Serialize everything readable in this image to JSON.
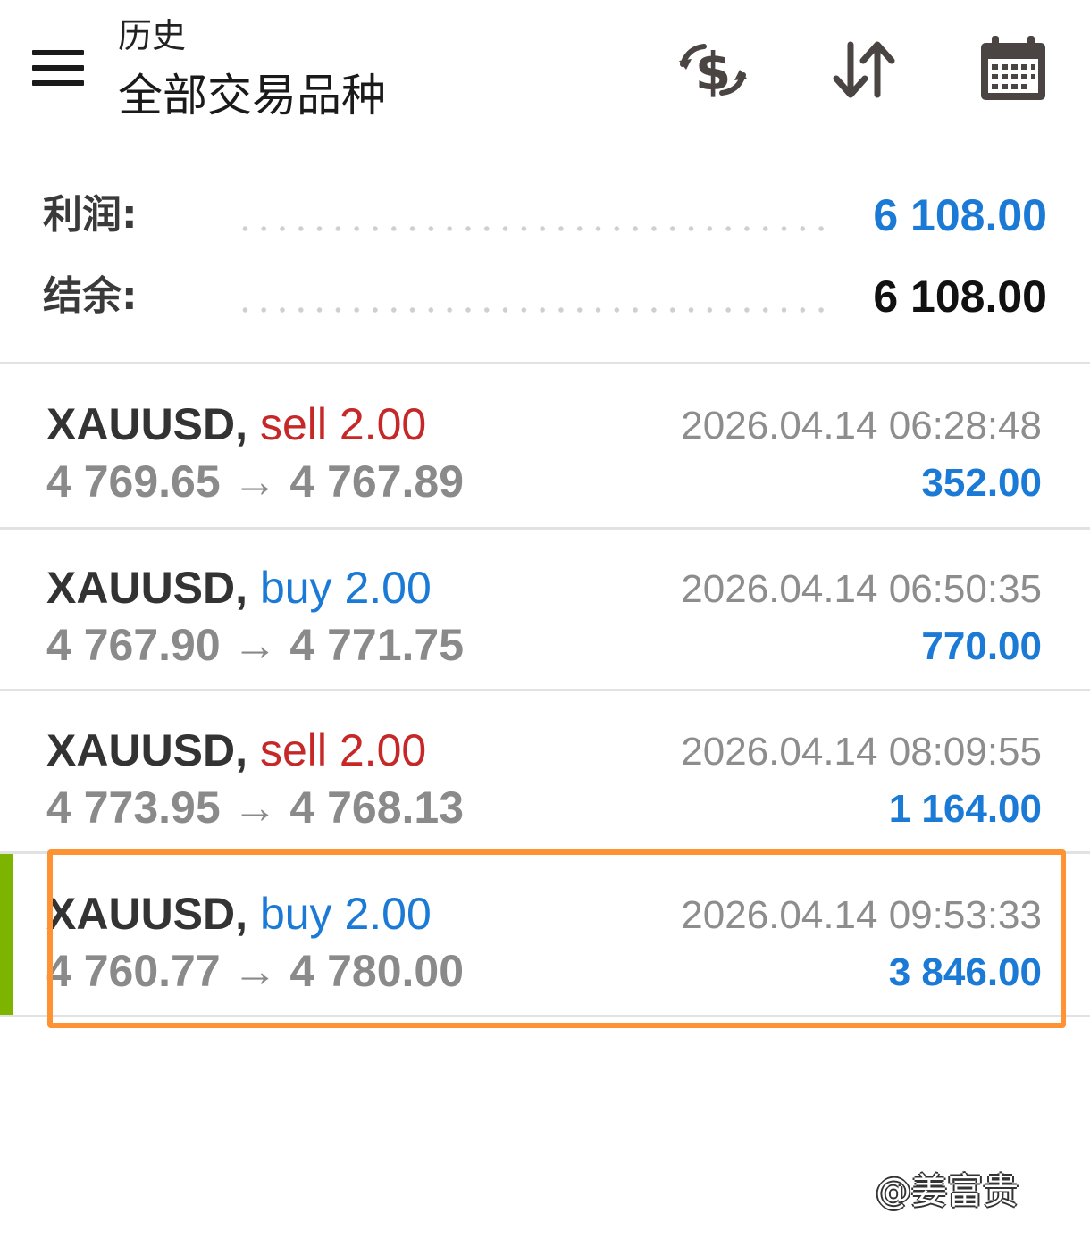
{
  "header": {
    "subtitle": "历史",
    "title": "全部交易品种",
    "icons": [
      "menu-icon",
      "currency-exchange-icon",
      "sort-icon",
      "calendar-icon"
    ]
  },
  "summary": {
    "profit_label": "利润:",
    "profit_value": "6 108.00",
    "balance_label": "结余:",
    "balance_value": "6 108.00"
  },
  "colors": {
    "sell": "#c62828",
    "buy": "#1a7ad6",
    "profit": "#1a7ad6",
    "selected_indicator": "#7cb400",
    "highlight": "#ff9233"
  },
  "deals": [
    {
      "symbol": "XAUUSD,",
      "type": "sell",
      "volume": "2.00",
      "prices": "4 769.65 → 4 767.89",
      "time": "2026.04.14 06:28:48",
      "profit": "352.00"
    },
    {
      "symbol": "XAUUSD,",
      "type": "buy",
      "volume": "2.00",
      "prices": "4 767.90 → 4 771.75",
      "time": "2026.04.14 06:50:35",
      "profit": "770.00"
    },
    {
      "symbol": "XAUUSD,",
      "type": "sell",
      "volume": "2.00",
      "prices": "4 773.95 → 4 768.13",
      "time": "2026.04.14 08:09:55",
      "profit": "1 164.00"
    },
    {
      "symbol": "XAUUSD,",
      "type": "buy",
      "volume": "2.00",
      "prices": "4 760.77 → 4 780.00",
      "time": "2026.04.14 09:53:33",
      "profit": "3 846.00",
      "selected": true
    }
  ],
  "watermark": "@姜富贵"
}
